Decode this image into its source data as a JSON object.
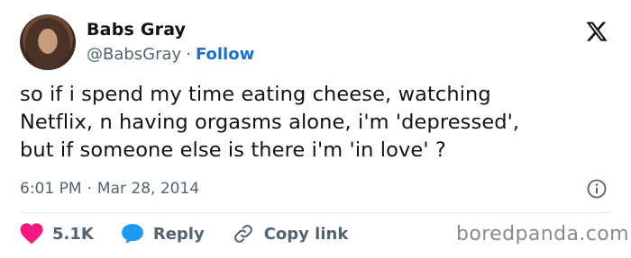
{
  "author": {
    "name": "Babs Gray",
    "handle": "@BabsGray",
    "separator": "·",
    "follow_label": "Follow"
  },
  "tweet": {
    "text_lines": [
      "so if i spend my time eating cheese, watching",
      "Netflix, n having orgasms alone, i'm 'depressed',",
      "but if someone else is there i'm 'in love' ?"
    ],
    "time": "6:01 PM",
    "date": "Mar 28, 2014",
    "separator": "·"
  },
  "actions": {
    "likes_count": "5.1K",
    "reply_label": "Reply",
    "copy_link_label": "Copy link"
  },
  "watermark": "boredpanda.com",
  "icons": {
    "logo": "x-logo-icon",
    "info": "info-icon",
    "like": "heart-icon",
    "reply": "speech-bubble-icon",
    "copy": "link-icon"
  },
  "colors": {
    "heart": "#f91880",
    "reply_bubble": "#1d9bf0",
    "follow": "#1d70c8",
    "secondary_text": "#536471"
  }
}
